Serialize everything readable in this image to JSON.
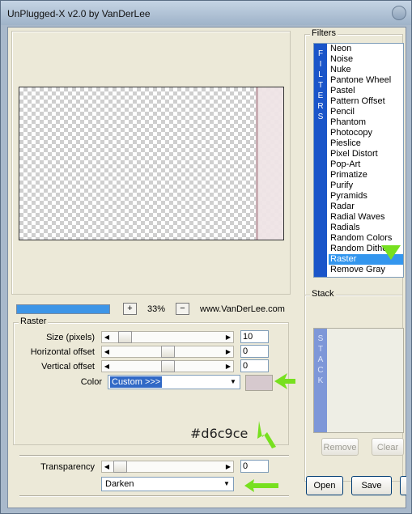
{
  "window": {
    "title": "UnPlugged-X v2.0 by VanDerLee"
  },
  "preview": {
    "progress_percent": 100,
    "zoom_level": "33%",
    "zoom_in": "+",
    "zoom_out": "−",
    "site": "www.VanDerLee.com"
  },
  "raster": {
    "group_label": "Raster",
    "size": {
      "label": "Size (pixels)",
      "value": "10"
    },
    "h_offset": {
      "label": "Horizontal offset",
      "value": "0"
    },
    "v_offset": {
      "label": "Vertical offset",
      "value": "0"
    },
    "color": {
      "label": "Color",
      "selected": "Custom >>>",
      "swatch": "#d6c9ce"
    },
    "annotation": "#d6c9ce"
  },
  "transparency": {
    "label": "Transparency",
    "value": "0"
  },
  "blend": {
    "selected": "Darken"
  },
  "filters": {
    "label": "Filters",
    "strip_text": "FILTERS",
    "items": [
      "Neon",
      "Noise",
      "Nuke",
      "Pantone Wheel",
      "Pastel",
      "Pattern Offset",
      "Pencil",
      "Phantom",
      "Photocopy",
      "Pieslice",
      "Pixel Distort",
      "Pop-Art",
      "Primatize",
      "Purify",
      "Pyramids",
      "Radar",
      "Radial Waves",
      "Radials",
      "Random Colors",
      "Random Dither",
      "Raster",
      "Remove Gray"
    ],
    "selected": "Raster"
  },
  "stack": {
    "label": "Stack",
    "strip_text": "STACK",
    "remove": "Remove",
    "clear": "Clear"
  },
  "buttons": {
    "open": "Open",
    "save": "Save"
  },
  "colors": {
    "arrow": "#77e01f",
    "accent": "#1a55c9",
    "selection": "#3396ee"
  }
}
